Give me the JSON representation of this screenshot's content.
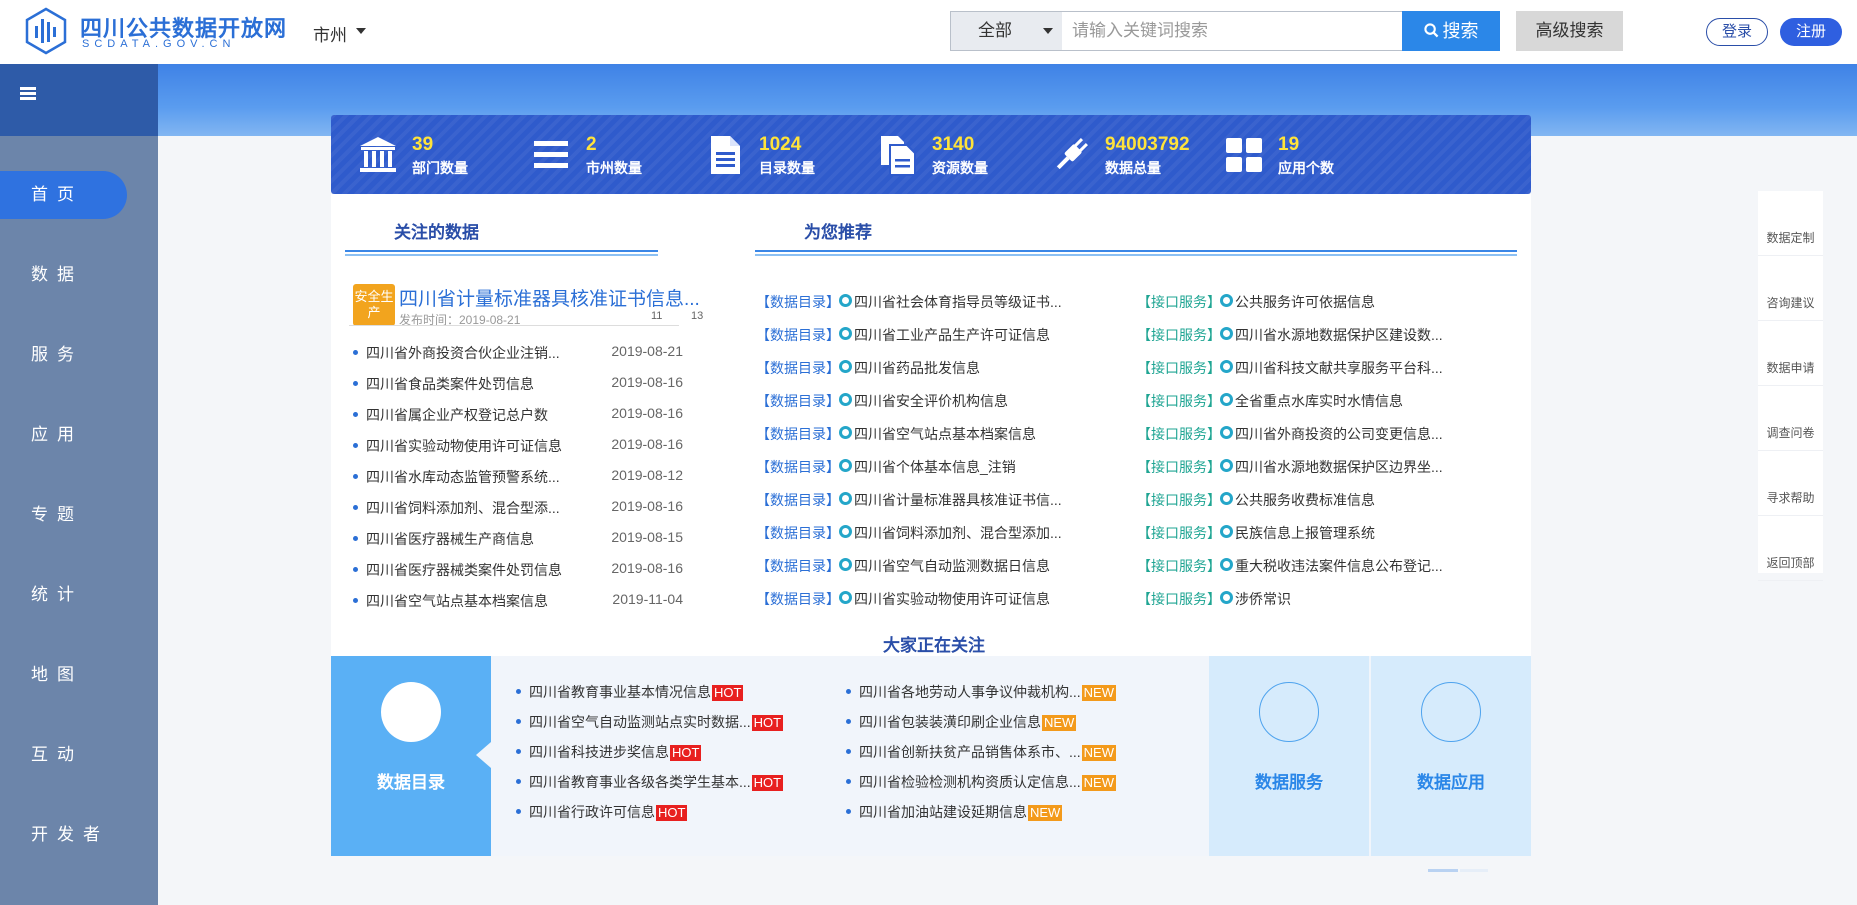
{
  "header": {
    "logo_title": "四川公共数据开放网",
    "logo_sub": "SCDATA.GOV.CN",
    "city_select": "市州",
    "search_scope": "全部",
    "search_placeholder": "请输入关键词搜索",
    "search_btn": "搜索",
    "advanced_btn": "高级搜索",
    "login_btn": "登录",
    "register_btn": "注册"
  },
  "sidebar": {
    "items": [
      {
        "label": "首页",
        "active": true
      },
      {
        "label": "数据"
      },
      {
        "label": "服务"
      },
      {
        "label": "应用"
      },
      {
        "label": "专题"
      },
      {
        "label": "统计"
      },
      {
        "label": "地图"
      },
      {
        "label": "互动"
      },
      {
        "label": "开发者"
      }
    ]
  },
  "stats": [
    {
      "value": "39",
      "label": "部门数量",
      "icon": "government-building-icon"
    },
    {
      "value": "2",
      "label": "市州数量",
      "icon": "list-icon"
    },
    {
      "value": "1024",
      "label": "目录数量",
      "icon": "document-icon"
    },
    {
      "value": "3140",
      "label": "资源数量",
      "icon": "files-icon"
    },
    {
      "value": "94003792",
      "label": "数据总量",
      "icon": "plug-icon"
    },
    {
      "value": "19",
      "label": "应用个数",
      "icon": "grid-icon"
    }
  ],
  "followed": {
    "title": "关注的数据",
    "featured": {
      "badge": "安全生产",
      "title": "四川省计量标准器具核准证书信息...",
      "date": "发布时间：2019-08-21",
      "count_a": "11",
      "count_b": "13"
    },
    "items": [
      {
        "name": "四川省外商投资合伙企业注销...",
        "date": "2019-08-21"
      },
      {
        "name": "四川省食品类案件处罚信息",
        "date": "2019-08-16"
      },
      {
        "name": "四川省属企业产权登记总户数",
        "date": "2019-08-16"
      },
      {
        "name": "四川省实验动物使用许可证信息",
        "date": "2019-08-16"
      },
      {
        "name": "四川省水库动态监管预警系统...",
        "date": "2019-08-12"
      },
      {
        "name": "四川省饲料添加剂、混合型添...",
        "date": "2019-08-16"
      },
      {
        "name": "四川省医疗器械生产商信息",
        "date": "2019-08-15"
      },
      {
        "name": "四川省医疗器械类案件处罚信息",
        "date": "2019-08-16"
      },
      {
        "name": "四川省空气站点基本档案信息",
        "date": "2019-11-04"
      }
    ]
  },
  "recommend": {
    "title": "为您推荐",
    "catalog_tag": "【数据目录】",
    "api_tag": "【接口服务】",
    "catalog": [
      "四川省社会体育指导员等级证书...",
      "四川省工业产品生产许可证信息",
      "四川省药品批发信息",
      "四川省安全评价机构信息",
      "四川省空气站点基本档案信息",
      "四川省个体基本信息_注销",
      "四川省计量标准器具核准证书信...",
      "四川省饲料添加剂、混合型添加...",
      "四川省空气自动监测数据日信息",
      "四川省实验动物使用许可证信息"
    ],
    "api": [
      "公共服务许可依据信息",
      "四川省水源地数据保护区建设数...",
      "四川省科技文献共享服务平台科...",
      "全省重点水库实时水情信息",
      "四川省外商投资的公司变更信息...",
      "四川省水源地数据保护区边界坐...",
      "公共服务收费标准信息",
      "民族信息上报管理系统",
      "重大税收违法案件信息公布登记...",
      "涉侨常识"
    ]
  },
  "popular": {
    "title": "大家正在关注",
    "catalog_label": "数据目录",
    "hot_badge": "HOT",
    "new_badge": "NEW",
    "hot": [
      "四川省教育事业基本情况信息",
      "四川省空气自动监测站点实时数据...",
      "四川省科技进步奖信息",
      "四川省教育事业各级各类学生基本...",
      "四川省行政许可信息"
    ],
    "new": [
      "四川省各地劳动人事争议仲裁机构...",
      "四川省包装装潢印刷企业信息",
      "四川省创新扶贫产品销售体系市、...",
      "四川省检验检测机构资质认定信息...",
      "四川省加油站建设延期信息"
    ],
    "service_label": "数据服务",
    "app_label": "数据应用"
  },
  "right_toolbar": [
    "数据定制",
    "咨询建议",
    "数据申请",
    "调查问卷",
    "寻求帮助",
    "返回顶部"
  ],
  "colors": {
    "brand": "#2b6fd6",
    "stats_bg": "#2f5bcc",
    "stat_value": "#ffe33a",
    "sidebar": "#6c85aa",
    "sidebar_active": "#2f72e0",
    "hot": "#e8201f",
    "new": "#f39a1b"
  }
}
